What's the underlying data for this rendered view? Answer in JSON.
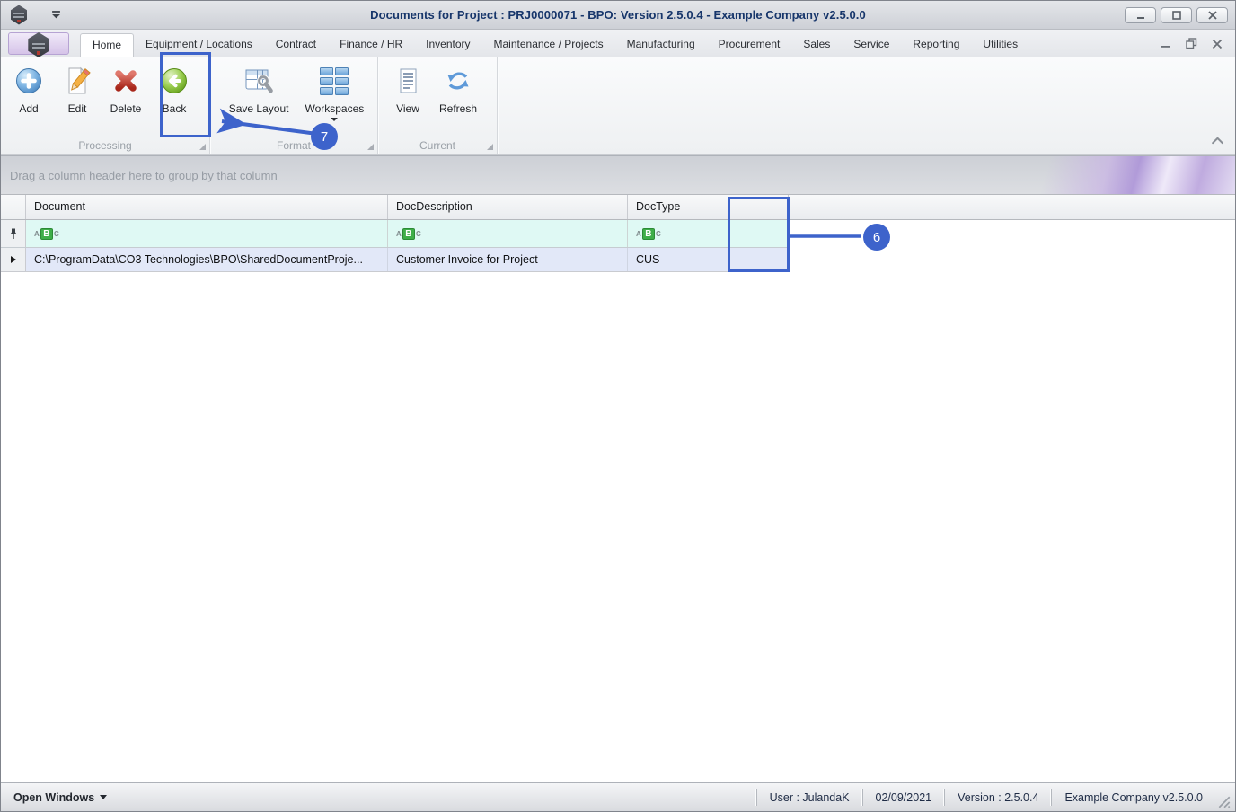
{
  "titlebar": {
    "title": "Documents for Project : PRJ0000071 - BPO: Version 2.5.0.4 - Example Company v2.5.0.0"
  },
  "tabs": [
    {
      "label": "Home"
    },
    {
      "label": "Equipment / Locations"
    },
    {
      "label": "Contract"
    },
    {
      "label": "Finance / HR"
    },
    {
      "label": "Inventory"
    },
    {
      "label": "Maintenance / Projects"
    },
    {
      "label": "Manufacturing"
    },
    {
      "label": "Procurement"
    },
    {
      "label": "Sales"
    },
    {
      "label": "Service"
    },
    {
      "label": "Reporting"
    },
    {
      "label": "Utilities"
    }
  ],
  "ribbon": {
    "groups": [
      {
        "label": "Processing",
        "buttons": [
          {
            "label": "Add",
            "icon": "add-icon"
          },
          {
            "label": "Edit",
            "icon": "edit-icon"
          },
          {
            "label": "Delete",
            "icon": "delete-icon"
          },
          {
            "label": "Back",
            "icon": "back-icon"
          }
        ]
      },
      {
        "label": "Format",
        "buttons": [
          {
            "label": "Save Layout",
            "icon": "save-layout-icon"
          },
          {
            "label": "Workspaces",
            "icon": "workspaces-icon",
            "has_dropdown": true
          }
        ]
      },
      {
        "label": "Current",
        "buttons": [
          {
            "label": "View",
            "icon": "view-icon"
          },
          {
            "label": "Refresh",
            "icon": "refresh-icon"
          }
        ]
      }
    ]
  },
  "grid": {
    "group_hint": "Drag a column header here to group by that column",
    "columns": [
      "Document",
      "DocDescription",
      "DocType"
    ],
    "filter_icon": {
      "a": "A",
      "b": "B",
      "c": "C"
    },
    "rows": [
      {
        "document": "C:\\ProgramData\\CO3 Technologies\\BPO\\SharedDocumentProje...",
        "doc_description": "Customer Invoice for Project",
        "doc_type": "CUS"
      }
    ]
  },
  "status_bar": {
    "open_windows": "Open Windows",
    "user": "User : JulandaK",
    "date": "02/09/2021",
    "version": "Version : 2.5.0.4",
    "company": "Example Company v2.5.0.0"
  },
  "annotations": {
    "callout_6": "6",
    "callout_7": "7"
  },
  "colors": {
    "annotation_blue": "#3d63cb",
    "filter_row_bg": "#dff9f4",
    "selected_row_bg": "#e2e8f8",
    "accent_green": "#76b041"
  }
}
